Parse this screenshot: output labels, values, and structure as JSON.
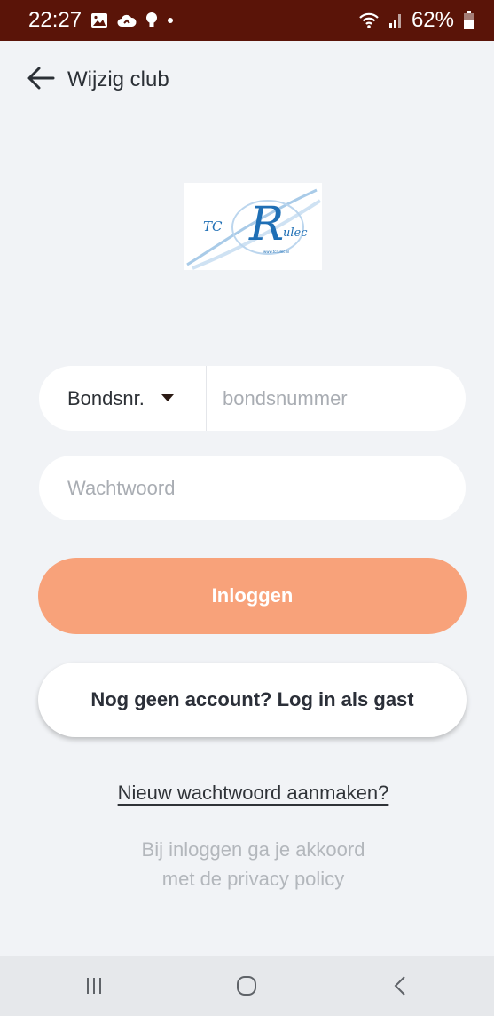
{
  "status_bar": {
    "time": "22:27",
    "battery": "62%",
    "icons": [
      "image-icon",
      "cloud-icon",
      "bulb-icon",
      "dot-icon",
      "wifi-icon",
      "signal-icon",
      "battery-icon"
    ]
  },
  "header": {
    "back_icon": "arrow-left-icon",
    "title": "Wijzig club"
  },
  "logo": {
    "text": "TC Rulec"
  },
  "login_form": {
    "id_type": {
      "selected": "Bondsnr.",
      "icon": "caret-down-icon"
    },
    "id_field": {
      "value": "",
      "placeholder": "bondsnummer"
    },
    "password_field": {
      "value": "",
      "placeholder": "Wachtwoord"
    },
    "login_button": "Inloggen",
    "guest_button": "Nog geen account? Log in als gast",
    "forgot_password_link": "Nieuw wachtwoord aanmaken?",
    "terms_line1": "Bij inloggen ga je akkoord",
    "terms_line2": "met de privacy policy"
  },
  "nav_bar": {
    "icons": [
      "recent-apps-icon",
      "home-icon",
      "back-icon"
    ]
  },
  "colors": {
    "status_bar": "#5a1408",
    "background": "#f1f3f6",
    "login_button": "#f8a27a",
    "logo_blue": "#1f6fb5"
  }
}
